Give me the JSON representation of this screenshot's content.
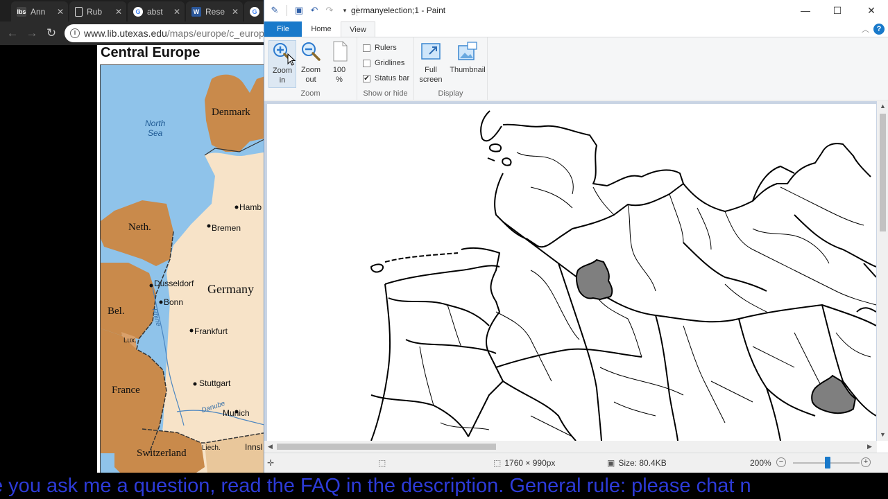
{
  "browser": {
    "tabs": [
      {
        "label": "Ann",
        "icon": "ibs-icon"
      },
      {
        "label": "Rub",
        "icon": "document-icon"
      },
      {
        "label": "abst",
        "icon": "google-icon"
      },
      {
        "label": "Rese",
        "icon": "word-icon"
      },
      {
        "label": "",
        "icon": "google-icon"
      }
    ],
    "close_glyph": "✕",
    "url_host": "www.lib.utexas.edu",
    "url_path": "/maps/europe/c_europ",
    "map": {
      "title": "Central Europe",
      "labels": {
        "north_sea_1": "North",
        "north_sea_2": "Sea",
        "denmark": "Denmark",
        "neth": "Neth.",
        "hamb": "Hamb",
        "bremen": "Bremen",
        "dusseldorf": "Dusseldorf",
        "bonn": "Bonn",
        "germany": "Germany",
        "rhine": "Rhine",
        "bel": "Bel.",
        "lux": "Lux.",
        "frankfurt": "Frankfurt",
        "stuttgart": "Stuttgart",
        "danube": "Danube",
        "munich": "Munich",
        "france": "France",
        "switzerland": "Switzerland",
        "liech": "Liech.",
        "innsbruck": "Innsl"
      }
    }
  },
  "paint": {
    "title": "germanyelection;1 - Paint",
    "window_controls": {
      "minimize": "—",
      "maximize": "☐",
      "close": "✕"
    },
    "ribbon_tabs": {
      "file": "File",
      "home": "Home",
      "view": "View"
    },
    "help": "?",
    "ribbon": {
      "zoom_group": {
        "title": "Zoom",
        "zoom_in_1": "Zoom",
        "zoom_in_2": "in",
        "zoom_out_1": "Zoom",
        "zoom_out_2": "out",
        "hundred_1": "100",
        "hundred_2": "%"
      },
      "show_hide_group": {
        "title": "Show or hide",
        "rulers": "Rulers",
        "rulers_checked": false,
        "gridlines": "Gridlines",
        "gridlines_checked": false,
        "status_bar": "Status bar",
        "status_bar_checked": true,
        "check_glyph": "✔"
      },
      "display_group": {
        "title": "Display",
        "full_screen_1": "Full",
        "full_screen_2": "screen",
        "thumbnail": "Thumbnail"
      }
    },
    "status": {
      "dimensions": "1760 × 990px",
      "size": "Size: 80.4KB",
      "zoom": "200%",
      "zoom_fraction": 0.52
    },
    "highlight_color": "#7f7f7f",
    "accent_color": "#1979ca"
  },
  "ticker": {
    "text": "e you ask me a question, read the FAQ in the description. General rule: please chat n"
  }
}
